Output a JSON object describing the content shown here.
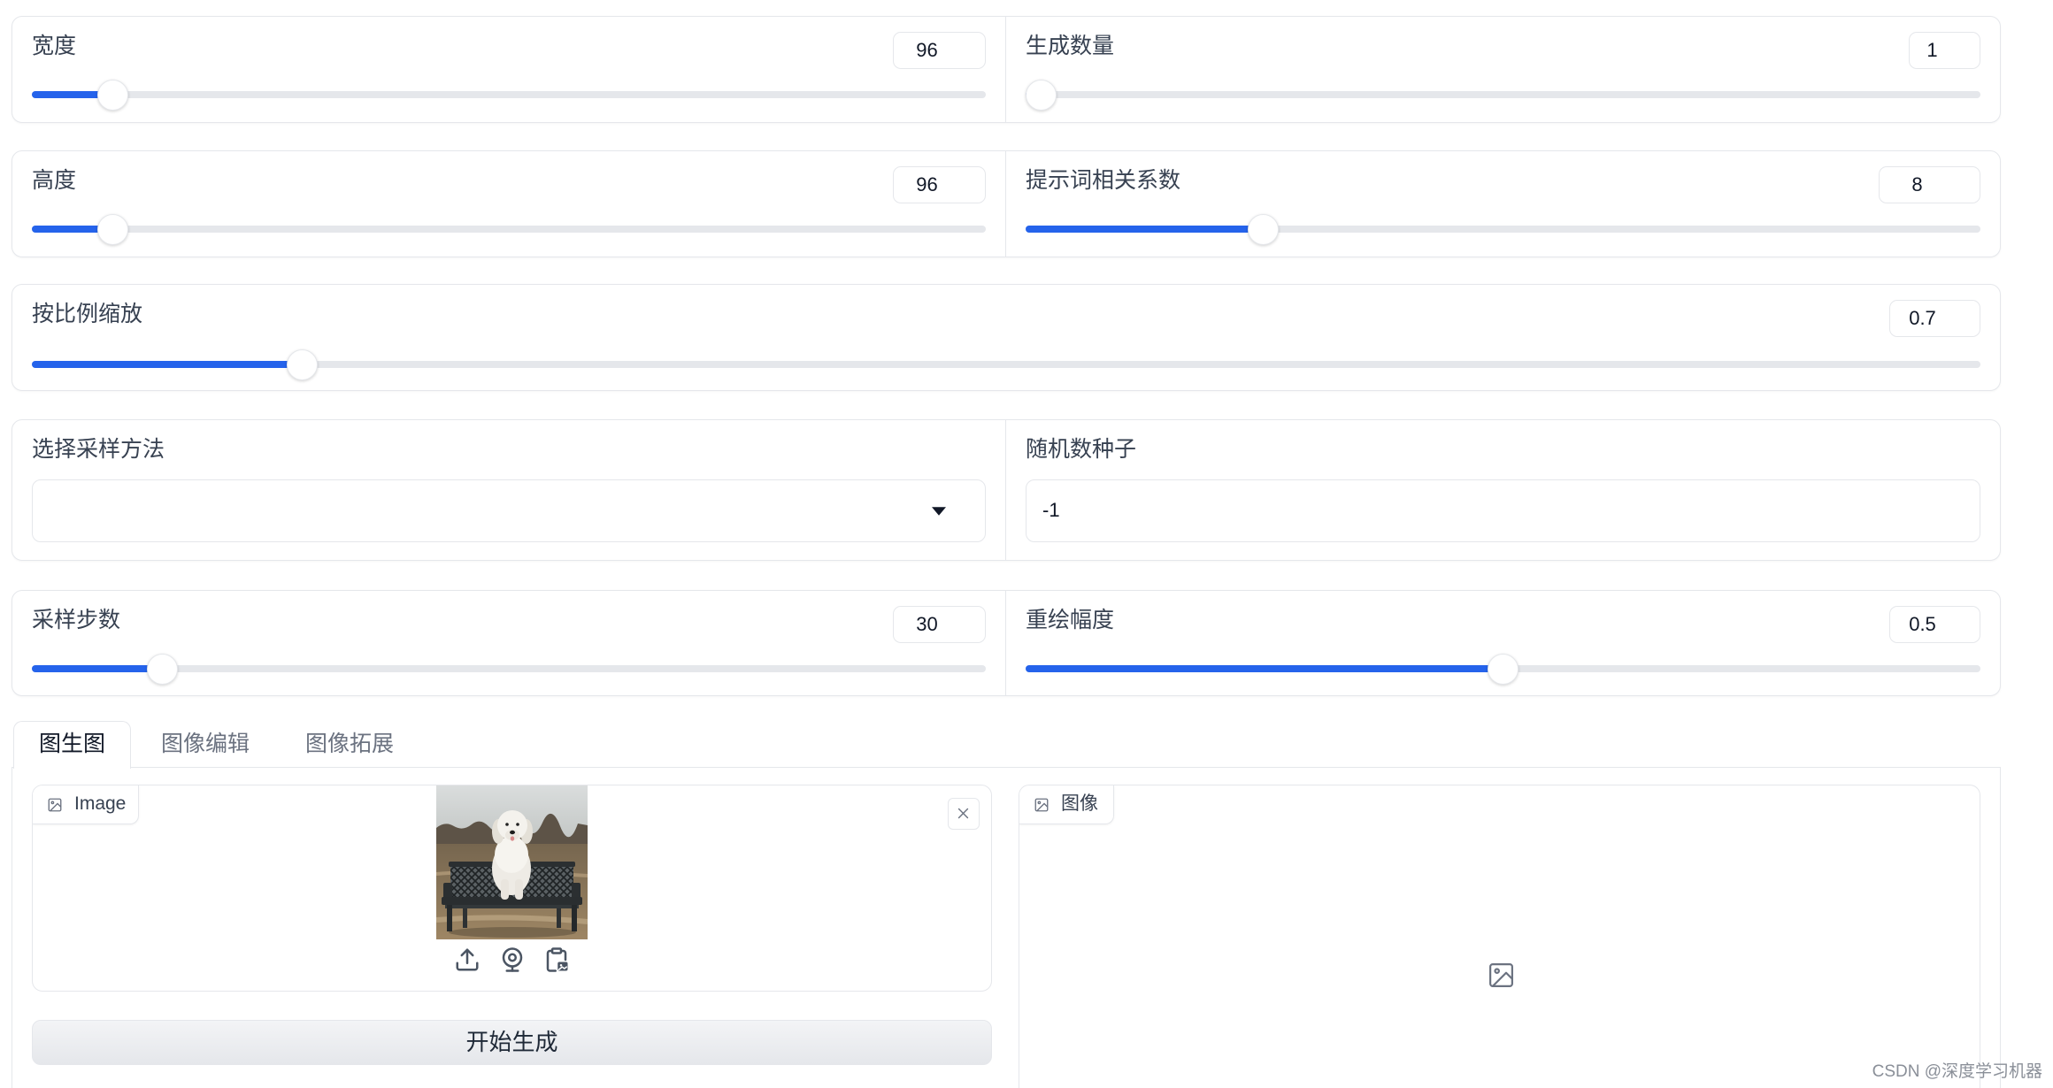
{
  "sliders": {
    "width": {
      "label": "宽度",
      "value": "96",
      "level": 0.071
    },
    "batch": {
      "label": "生成数量",
      "value": "1",
      "level": 0
    },
    "height": {
      "label": "高度",
      "value": "96",
      "level": 0.071
    },
    "cfg": {
      "label": "提示词相关系数",
      "value": "8",
      "level": 0.24
    },
    "scale": {
      "label": "按比例缩放",
      "value": "0.7",
      "level": 0.133
    },
    "steps": {
      "label": "采样步数",
      "value": "30",
      "level": 0.125
    },
    "strength": {
      "label": "重绘幅度",
      "value": "0.5",
      "level": 0.5
    }
  },
  "sampler": {
    "label": "选择采样方法"
  },
  "seed": {
    "label": "随机数种子",
    "value": "-1"
  },
  "tabs": [
    {
      "label": "图生图",
      "selected": true
    },
    {
      "label": "图像编辑",
      "selected": false
    },
    {
      "label": "图像拓展",
      "selected": false
    }
  ],
  "input_image": {
    "label": "Image"
  },
  "output_image": {
    "label": "图像"
  },
  "generate_button": {
    "label": "开始生成"
  },
  "watermark": "CSDN @深度学习机器",
  "colors": {
    "accent": "#2563eb",
    "border": "#e5e7eb"
  },
  "icons": {
    "image_badge": "image-icon",
    "upload": "upload-icon",
    "webcam": "webcam-icon",
    "clipboard": "clipboard-icon",
    "clear": "close-icon",
    "dropdown": "chevron-down-icon",
    "output_placeholder": "image-icon"
  }
}
